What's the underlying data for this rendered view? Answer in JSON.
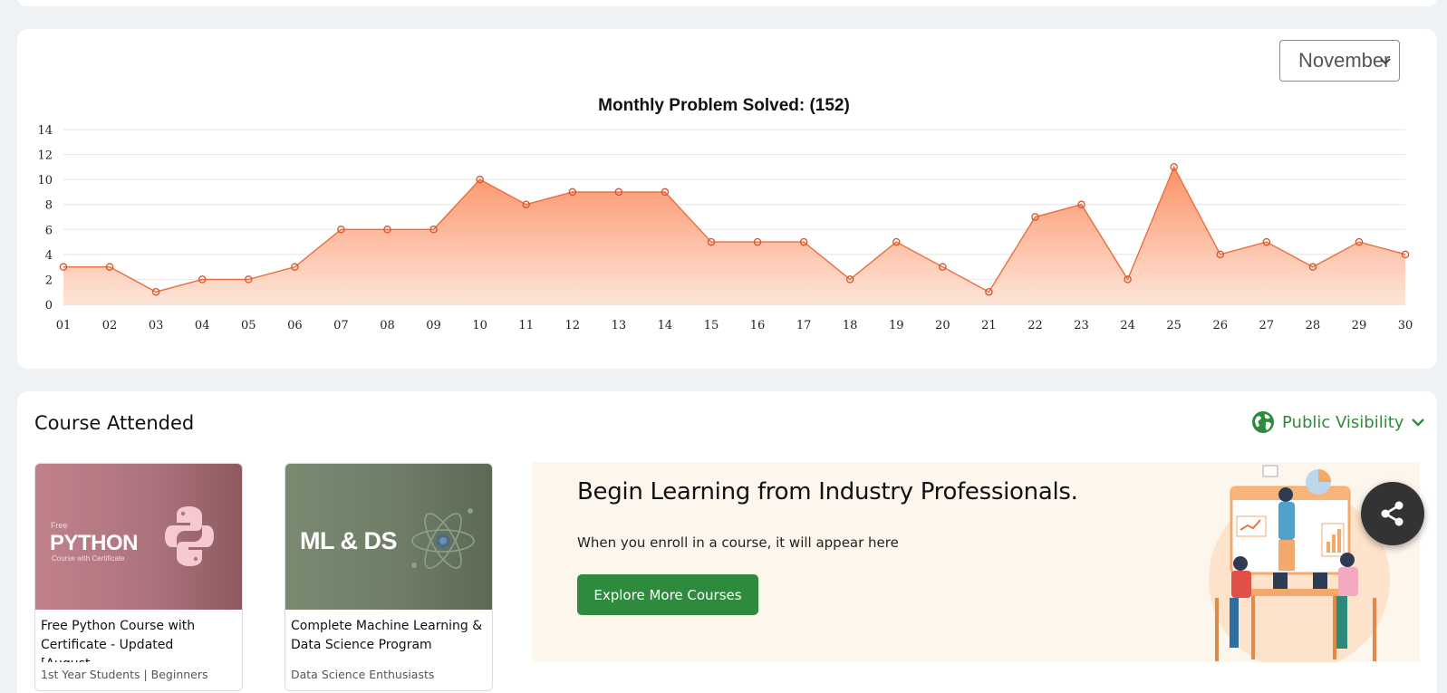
{
  "month_select": {
    "selected": "November"
  },
  "chart_data": {
    "type": "area",
    "title": "Monthly Problem Solved: (152)",
    "xlabel": "",
    "ylabel": "",
    "ylim": [
      0,
      14
    ],
    "yticks": [
      0,
      2,
      4,
      6,
      8,
      10,
      12,
      14
    ],
    "grid": true,
    "legend": "none",
    "categories": [
      "01",
      "02",
      "03",
      "04",
      "05",
      "06",
      "07",
      "08",
      "09",
      "10",
      "11",
      "12",
      "13",
      "14",
      "15",
      "16",
      "17",
      "18",
      "19",
      "20",
      "21",
      "22",
      "23",
      "24",
      "25",
      "26",
      "27",
      "28",
      "29",
      "30"
    ],
    "values": [
      3,
      3,
      1,
      2,
      2,
      3,
      6,
      6,
      6,
      10,
      8,
      9,
      9,
      9,
      5,
      5,
      5,
      2,
      5,
      3,
      1,
      7,
      8,
      2,
      11,
      4,
      5,
      3,
      5,
      4
    ],
    "colors": {
      "line": "#ec6d3c",
      "fill_top": "#fc8b5e",
      "fill_bottom": "#fde2d4"
    }
  },
  "course_section": {
    "title": "Course Attended",
    "visibility_label": "Public Visibility",
    "accent": "#2e8b3e",
    "courses": [
      {
        "title": "Free Python Course with Certificate - Updated [August…",
        "audience": "1st Year Students | Beginners",
        "thumb_small": "Free",
        "thumb_big": "PYTHON",
        "thumb_sub": "Course with Certificate",
        "icon": "python-logo-icon"
      },
      {
        "title": "Complete Machine Learning & Data Science Program",
        "audience": "Data Science Enthusiasts",
        "thumb_big": "ML & DS",
        "icon": "atom-icon"
      }
    ]
  },
  "promo": {
    "heading": "Begin Learning from Industry Professionals.",
    "text": "When you enroll in a course, it will appear here",
    "button_label": "Explore More Courses"
  },
  "share": {
    "icon": "share-icon"
  }
}
